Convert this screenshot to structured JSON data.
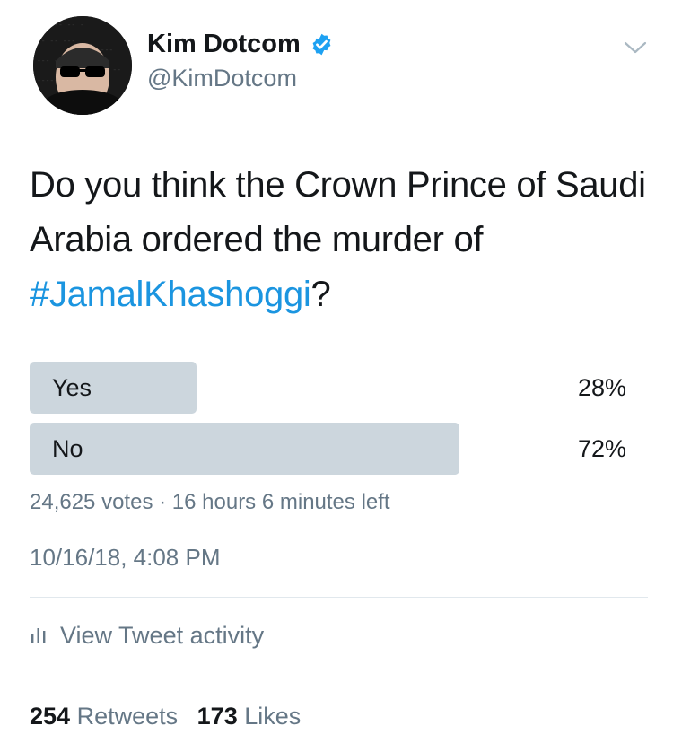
{
  "author": {
    "name": "Kim Dotcom",
    "handle": "@KimDotcom",
    "verified": true,
    "avatar_icon": "profile-photo"
  },
  "tweet": {
    "text_before": "Do you think the Crown Prince of Saudi Arabia ordered the murder of ",
    "hashtag": "#JamalKhashoggi",
    "text_after": "?"
  },
  "poll": {
    "options": [
      {
        "label": "Yes",
        "percent_text": "28%",
        "share": 0.28
      },
      {
        "label": "No",
        "percent_text": "72%",
        "share": 0.72
      }
    ],
    "votes_text": "24,625 votes",
    "separator": "·",
    "time_left_text": "16 hours 6 minutes left"
  },
  "timestamp": "10/16/18, 4:08 PM",
  "activity": {
    "label": "View Tweet activity",
    "icon": "bar-chart-icon"
  },
  "stats": {
    "retweets_count": "254",
    "retweets_label": "Retweets",
    "likes_count": "173",
    "likes_label": "Likes"
  },
  "colors": {
    "hashtag": "#1b95e0",
    "verified": "#1da1f2",
    "poll_bar": "#ccd6dd",
    "secondary_text": "#657786"
  }
}
